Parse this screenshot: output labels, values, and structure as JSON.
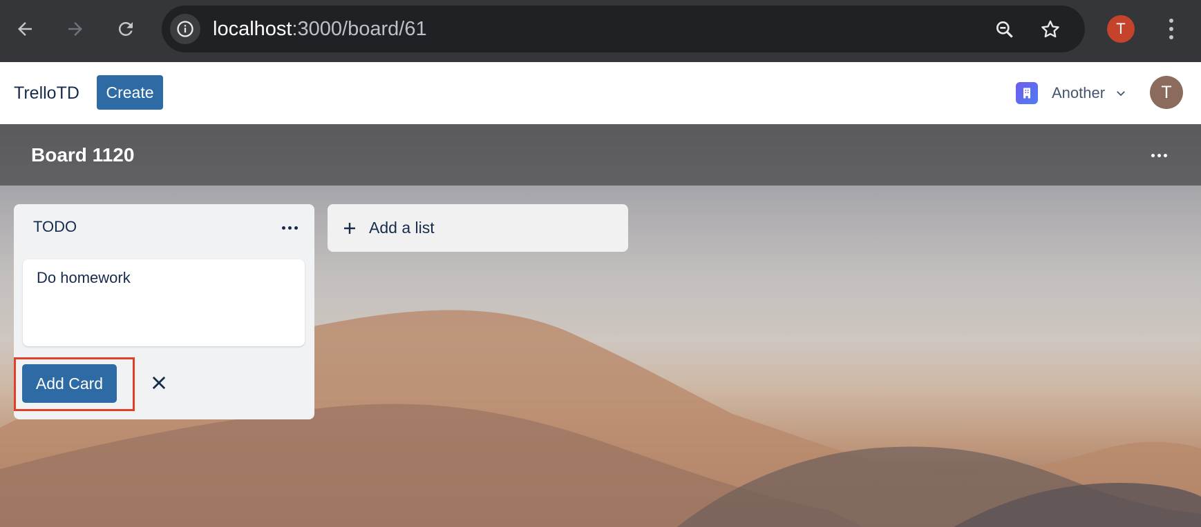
{
  "browser": {
    "url_host": "localhost",
    "url_rest": ":3000/board/61",
    "profile_initial": "T"
  },
  "header": {
    "app_name": "TrelloTD",
    "create_label": "Create",
    "workspace_label": "Another",
    "avatar_initial": "T"
  },
  "board": {
    "title": "Board 1120",
    "lists": [
      {
        "title": "TODO",
        "new_card_text": "Do homework",
        "add_card_label": "Add Card"
      }
    ],
    "add_list_label": "Add a list"
  },
  "colors": {
    "primary_button": "#2e6aa3",
    "highlight": "#e0402a",
    "workspace_icon": "#6e5dea"
  }
}
